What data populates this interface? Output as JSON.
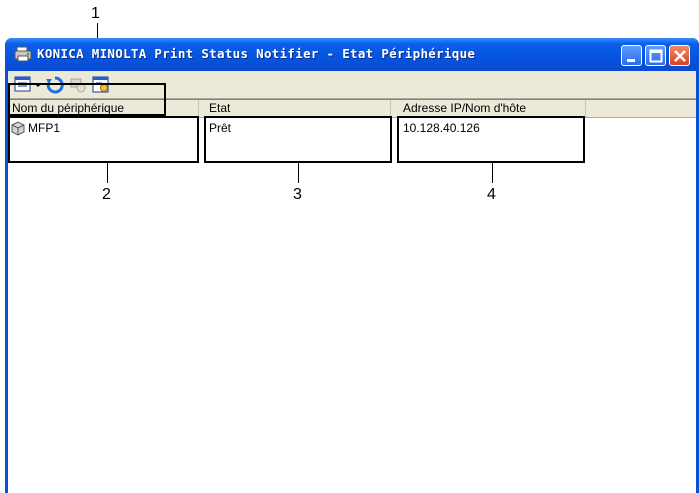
{
  "callouts": {
    "c1": "1",
    "c2": "2",
    "c3": "3",
    "c4": "4"
  },
  "window": {
    "title": "KONICA MINOLTA Print Status Notifier - Etat Périphérique",
    "controls": [
      "minimize",
      "maximize",
      "close"
    ]
  },
  "toolbar": {
    "buttons": [
      {
        "icon": "view-menu-icon",
        "has_dropdown": true
      },
      {
        "icon": "refresh-icon"
      },
      {
        "icon": "device-action-icon",
        "disabled": true
      },
      {
        "icon": "properties-icon"
      }
    ]
  },
  "list": {
    "columns": [
      "Nom du périphérique",
      "Etat",
      "Adresse IP/Nom d'hôte"
    ],
    "rows": [
      {
        "name": "MFP1",
        "status": "Prêt",
        "address": "10.128.40.126"
      }
    ]
  },
  "colors": {
    "titlebar": "#0a5fe8",
    "close_button": "#d8431f",
    "face": "#ece9d8"
  }
}
